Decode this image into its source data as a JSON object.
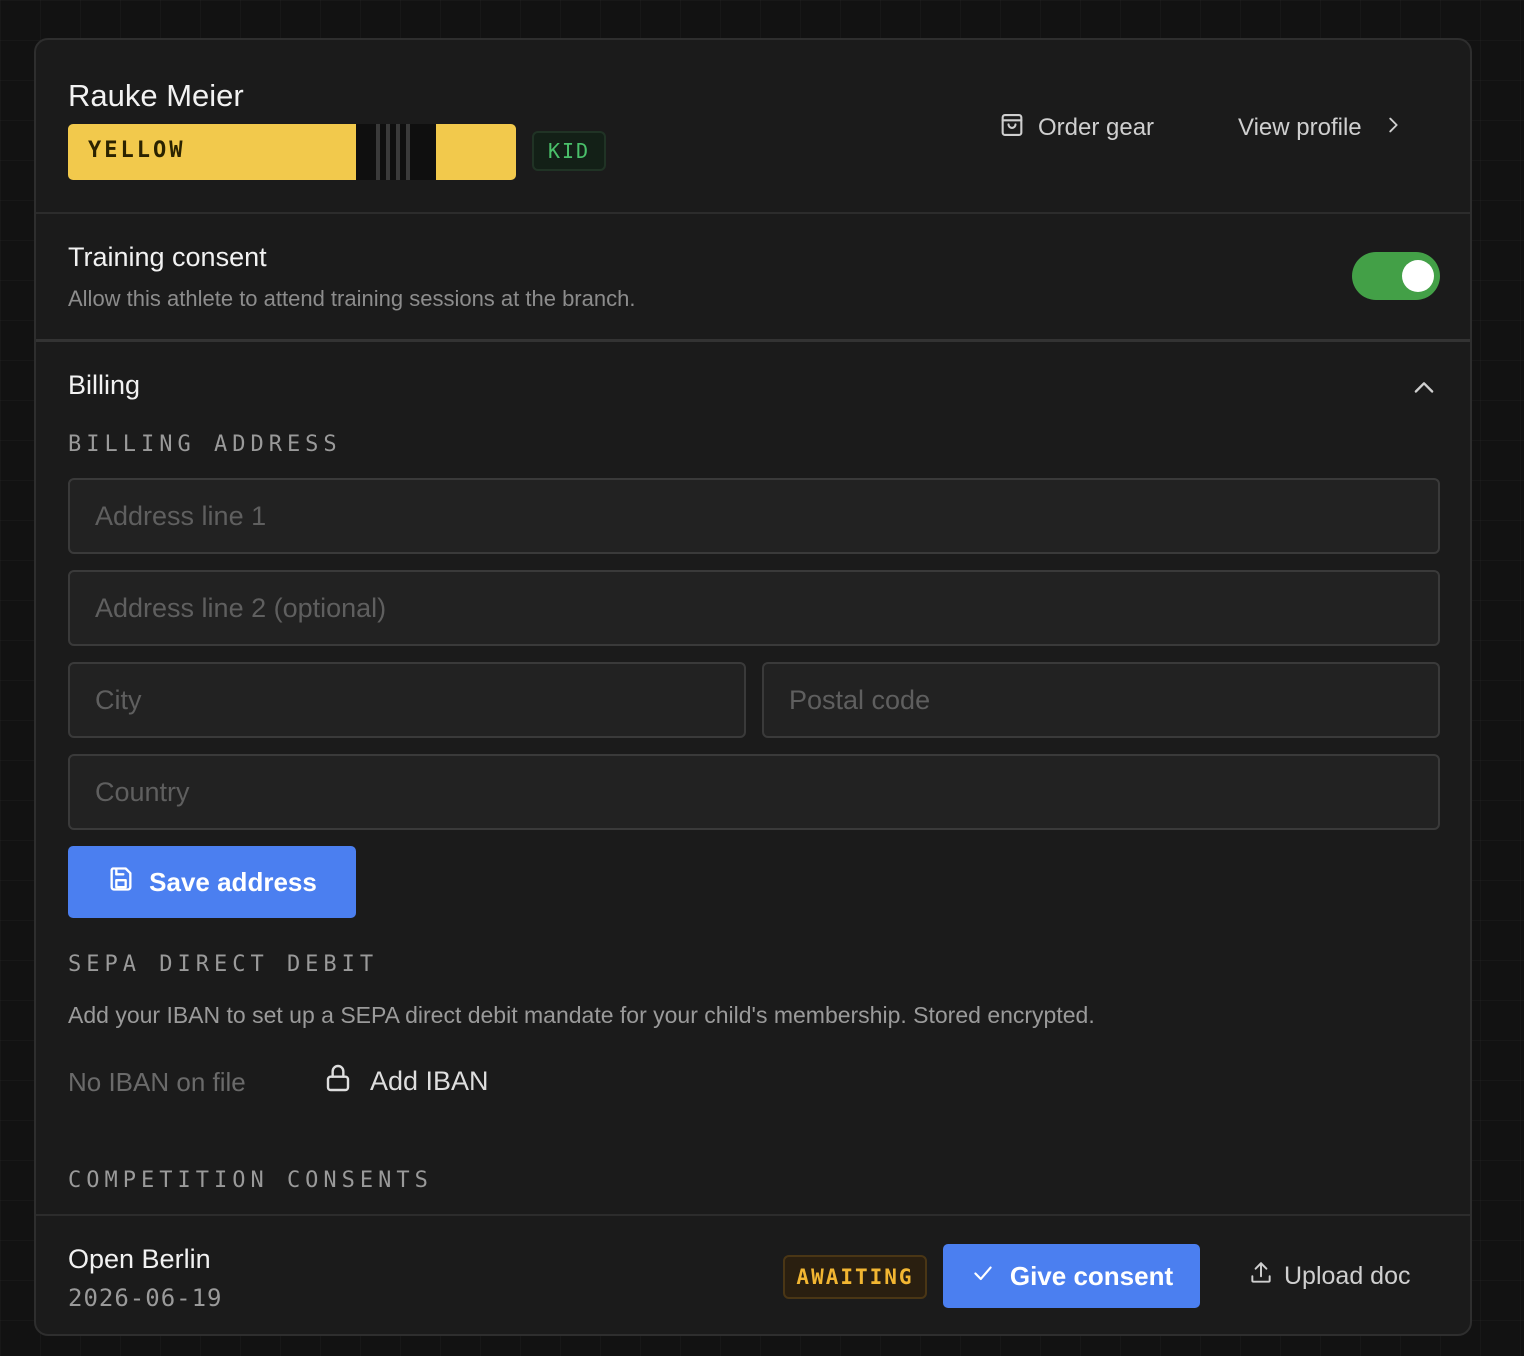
{
  "athlete": {
    "name": "Rauke Meier",
    "belt_label": "YELLOW",
    "belt_color": "#f2c94c",
    "badge": "KID"
  },
  "header": {
    "order_gear": "Order gear",
    "view_profile": "View profile"
  },
  "consent": {
    "title": "Training consent",
    "description": "Allow this athlete to attend training sessions at the branch.",
    "enabled": true,
    "toggle_color": "#43a047"
  },
  "billing": {
    "title": "Billing",
    "address_label": "BILLING ADDRESS",
    "fields": {
      "line1_placeholder": "Address line 1",
      "line2_placeholder": "Address line 2 (optional)",
      "city_placeholder": "City",
      "postal_placeholder": "Postal code",
      "country_placeholder": "Country"
    },
    "save_label": "Save address",
    "sepa_label": "SEPA DIRECT DEBIT",
    "sepa_description": "Add your IBAN to set up a SEPA direct debit mandate for your child's membership. Stored encrypted.",
    "no_iban": "No IBAN on file",
    "add_iban": "Add IBAN"
  },
  "competition": {
    "label": "COMPETITION CONSENTS",
    "events": [
      {
        "name": "Open Berlin",
        "date": "2026-06-19",
        "status": "AWAITING",
        "give_consent": "Give consent",
        "upload_doc": "Upload doc"
      }
    ]
  },
  "colors": {
    "accent": "#4b7ff0",
    "status_awaiting": "#f2b632",
    "kid_badge": "#4ac06a"
  }
}
